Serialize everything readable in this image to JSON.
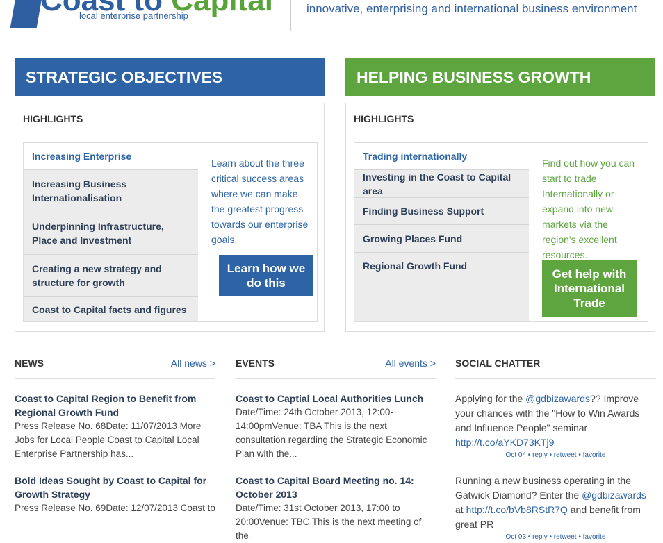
{
  "header": {
    "logo_blue": "Coast to",
    "logo_green": "Capital",
    "logo_sub": "local enterprise partnership",
    "tagline": "innovative, enterprising and international business environment"
  },
  "strategic": {
    "title": "STRATEGIC OBJECTIVES",
    "highlights_label": "HIGHLIGHTS",
    "items": [
      "Increasing Enterprise",
      "Increasing Business Internationalisation",
      "Underpinning Infrastructure, Place and Investment",
      "Creating a new strategy and structure for growth",
      "Coast to Capital facts and figures"
    ],
    "description": "Learn about the three critical success areas where we can make the greatest progress towards our enterprise goals.",
    "cta": "Learn how we do this"
  },
  "growth": {
    "title": "HELPING BUSINESS GROWTH",
    "highlights_label": "HIGHLIGHTS",
    "items": [
      "Trading internationally",
      "Investing in the Coast to Capital area",
      "Finding Business Support",
      "Growing Places Fund",
      "Regional Growth Fund"
    ],
    "description": "Find out how you can start to trade Internationally or expand into new markets via the region's excellent resources.",
    "cta": "Get help with International Trade"
  },
  "news": {
    "title": "NEWS",
    "link": "All news >",
    "items": [
      {
        "title": "Coast to Capital Region to Benefit from Regional Growth Fund",
        "text": "Press Release No. 68Date: 11/07/2013 More Jobs for Local People Coast to Capital Local Enterprise Partnership has..."
      },
      {
        "title": "Bold Ideas Sought by Coast to Capital for Growth Strategy",
        "text": "Press Release No. 69Date: 12/07/2013 Coast to"
      }
    ]
  },
  "events": {
    "title": "EVENTS",
    "link": "All events >",
    "items": [
      {
        "title": "Coast to Captial Local Authorities Lunch",
        "text": "Date/Time: 24th October 2013, 12:00-14:00pmVenue: TBA This is the next consultation regarding the Strategic Economic Plan with the..."
      },
      {
        "title": "Coast to Capital Board Meeting no. 14: October 2013",
        "text": "Date/Time: 31st October 2013, 17:00 to 20:00Venue: TBC This is the next meeting of the"
      }
    ]
  },
  "social": {
    "title": "SOCIAL CHATTER",
    "tweets": [
      {
        "pre": "Applying for the ",
        "handle": "@gdbizawards",
        "mid": "?? Improve your chances with the \"How to Win Awards and Influence People\" seminar ",
        "link": "http://t.co/aYKD73KTj9",
        "post": "",
        "meta": "Oct 04 • reply • retweet • favorite"
      },
      {
        "pre": "Running a new business operating in the Gatwick Diamond? Enter the ",
        "handle": "@gdbizawards",
        "mid": " at ",
        "link": "http://t.co/bVb8RStR7Q",
        "post": " and benefit from great PR",
        "meta": "Oct 03 • reply • retweet • favorite"
      }
    ]
  },
  "colors": {
    "blue": "#2e64a6",
    "green": "#5ea540"
  }
}
